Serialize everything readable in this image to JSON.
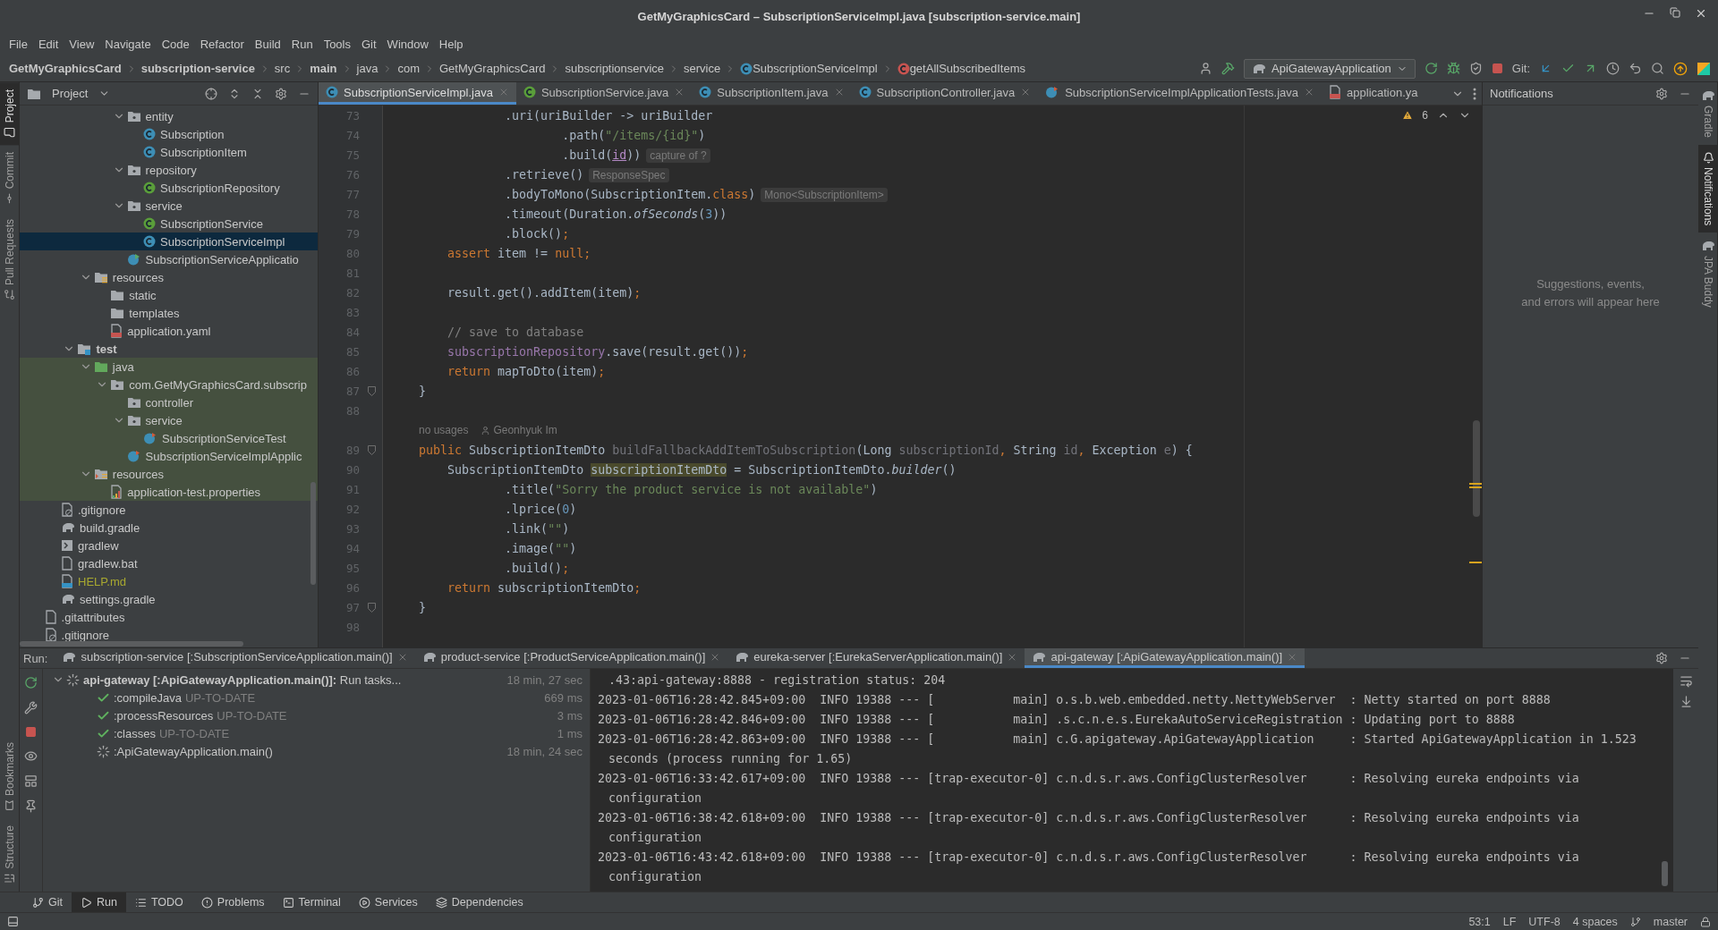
{
  "window": {
    "title": "GetMyGraphicsCard – SubscriptionServiceImpl.java [subscription-service.main]"
  },
  "menu": [
    "File",
    "Edit",
    "View",
    "Navigate",
    "Code",
    "Refactor",
    "Build",
    "Run",
    "Tools",
    "Git",
    "Window",
    "Help"
  ],
  "breadcrumbs": [
    {
      "label": "GetMyGraphicsCard",
      "bold": true
    },
    {
      "label": "subscription-service",
      "bold": true
    },
    {
      "label": "src"
    },
    {
      "label": "main",
      "bold": true
    },
    {
      "label": "java"
    },
    {
      "label": "com"
    },
    {
      "label": "GetMyGraphicsCard"
    },
    {
      "label": "subscriptionservice"
    },
    {
      "label": "service"
    },
    {
      "label": "SubscriptionServiceImpl",
      "kind": "class"
    },
    {
      "label": "getAllSubscribedItems",
      "kind": "method"
    }
  ],
  "toolbar": {
    "run_config": "ApiGatewayApplication",
    "git_label": "Git:"
  },
  "left_stripe": {
    "top": [
      {
        "label": "Project",
        "kind": "folder",
        "selected": true
      },
      {
        "label": "Commit",
        "kind": "commit",
        "selected": false
      },
      {
        "label": "Pull Requests",
        "kind": "pull",
        "selected": false
      }
    ],
    "bottom": [
      {
        "label": "Bookmarks",
        "kind": "bookmark",
        "selected": false
      },
      {
        "label": "Structure",
        "kind": "structure",
        "selected": false
      }
    ]
  },
  "right_stripe": [
    {
      "label": "Gradle",
      "kind": "gradle",
      "selected": false
    },
    {
      "label": "Notifications",
      "kind": "bell",
      "selected": true
    },
    {
      "label": "JPA Buddy",
      "kind": "gradle",
      "selected": false
    }
  ],
  "project": {
    "title": "Project",
    "items": [
      {
        "children": [
          {
            "children": [
              {
                "children": [
                  {
                    "children": [
                      {
                        "children": [
                          {
                            "label": "entity",
                            "kind": "package",
                            "expanded": true,
                            "children": [
                              {
                                "label": "Subscription",
                                "kind": "class"
                              },
                              {
                                "label": "SubscriptionItem",
                                "kind": "class"
                              }
                            ]
                          },
                          {
                            "label": "repository",
                            "kind": "package",
                            "expanded": true,
                            "children": [
                              {
                                "label": "SubscriptionRepository",
                                "kind": "interface"
                              }
                            ]
                          },
                          {
                            "label": "service",
                            "kind": "package",
                            "expanded": true,
                            "children": [
                              {
                                "label": "SubscriptionService",
                                "kind": "interface"
                              },
                              {
                                "label": "SubscriptionServiceImpl",
                                "kind": "class",
                                "selected": true
                              }
                            ]
                          },
                          {
                            "label": "SubscriptionServiceApplicatio",
                            "kind": "app-class"
                          }
                        ]
                      }
                    ]
                  },
                  {
                    "label": "resources",
                    "kind": "resources-folder",
                    "expanded": true,
                    "children": [
                      {
                        "label": "static",
                        "kind": "folder"
                      },
                      {
                        "label": "templates",
                        "kind": "folder"
                      },
                      {
                        "label": "application.yaml",
                        "kind": "yaml"
                      }
                    ]
                  }
                ]
              },
              {
                "label": "test",
                "kind": "test-root",
                "expanded": true,
                "bold": true,
                "children": [
                  {
                    "label": "java",
                    "kind": "source-folder",
                    "expanded": true,
                    "highlighted": true,
                    "children": [
                      {
                        "label": "com.GetMyGraphicsCard.subscrip",
                        "kind": "package",
                        "expanded": true,
                        "highlighted": true,
                        "children": [
                          {
                            "label": "controller",
                            "kind": "package",
                            "highlighted": true
                          },
                          {
                            "label": "service",
                            "kind": "package",
                            "expanded": true,
                            "highlighted": true,
                            "children": [
                              {
                                "label": "SubscriptionServiceTest",
                                "kind": "test-class",
                                "highlighted": true
                              }
                            ]
                          },
                          {
                            "label": "SubscriptionServiceImplApplic",
                            "kind": "test-class",
                            "highlighted": true
                          }
                        ]
                      }
                    ]
                  },
                  {
                    "label": "resources",
                    "kind": "test-resources",
                    "expanded": true,
                    "highlighted": true,
                    "children": [
                      {
                        "label": "application-test.properties",
                        "kind": "properties",
                        "highlighted": true
                      }
                    ]
                  }
                ]
              }
            ]
          },
          {
            "label": ".gitignore",
            "kind": "ignore"
          },
          {
            "label": "build.gradle",
            "kind": "gradle"
          },
          {
            "label": "gradlew",
            "kind": "script"
          },
          {
            "label": "gradlew.bat",
            "kind": "text"
          },
          {
            "label": "HELP.md",
            "kind": "markdown",
            "unversioned": true
          },
          {
            "label": "settings.gradle",
            "kind": "gradle"
          }
        ]
      },
      {
        "label": ".gitattributes",
        "kind": "text"
      },
      {
        "label": ".gitignore",
        "kind": "ignore"
      }
    ]
  },
  "editor": {
    "tabs": [
      {
        "label": "SubscriptionServiceImpl.java",
        "kind": "class",
        "selected": true,
        "closable": true
      },
      {
        "label": "SubscriptionService.java",
        "kind": "interface",
        "selected": false,
        "closable": true
      },
      {
        "label": "SubscriptionItem.java",
        "kind": "class",
        "selected": false,
        "closable": true
      },
      {
        "label": "SubscriptionController.java",
        "kind": "class",
        "selected": false,
        "closable": true
      },
      {
        "label": "SubscriptionServiceImplApplicationTests.java",
        "kind": "test-class",
        "selected": false,
        "closable": true
      },
      {
        "label": "application.ya",
        "kind": "yaml",
        "selected": false,
        "closable": false
      }
    ],
    "warnings": "6",
    "lines": [
      {
        "kind": "code",
        "number": "73",
        "tokens": [
          {
            "kind": "plain",
            "text": "                .uri(uriBuilder -> uriBuilder"
          }
        ]
      },
      {
        "kind": "code",
        "number": "74",
        "tokens": [
          {
            "kind": "plain",
            "text": "                        .path("
          },
          {
            "kind": "string",
            "text": "\"/items/{id}\""
          },
          {
            "kind": "plain",
            "text": ")"
          }
        ]
      },
      {
        "kind": "code",
        "number": "75",
        "tokens": [
          {
            "kind": "plain",
            "text": "                        .build("
          },
          {
            "kind": "ref",
            "text": "id"
          },
          {
            "kind": "plain",
            "text": "))"
          },
          {
            "kind": "hint",
            "text": "capture of ?"
          }
        ]
      },
      {
        "kind": "code",
        "number": "76",
        "tokens": [
          {
            "kind": "plain",
            "text": "                .retrieve()"
          },
          {
            "kind": "hint",
            "text": "ResponseSpec"
          }
        ]
      },
      {
        "kind": "code",
        "number": "77",
        "tokens": [
          {
            "kind": "plain",
            "text": "                .bodyToMono(SubscriptionItem."
          },
          {
            "kind": "keyword",
            "text": "class"
          },
          {
            "kind": "plain",
            "text": ")"
          },
          {
            "kind": "hint",
            "text": "Mono<SubscriptionItem>"
          }
        ]
      },
      {
        "kind": "code",
        "number": "78",
        "tokens": [
          {
            "kind": "plain",
            "text": "                .timeout(Duration."
          },
          {
            "kind": "italic",
            "text": "ofSeconds"
          },
          {
            "kind": "plain",
            "text": "("
          },
          {
            "kind": "number",
            "text": "3"
          },
          {
            "kind": "plain",
            "text": "))"
          }
        ]
      },
      {
        "kind": "code",
        "number": "79",
        "tokens": [
          {
            "kind": "plain",
            "text": "                .block()"
          },
          {
            "kind": "keyword",
            "text": ";"
          }
        ]
      },
      {
        "kind": "code",
        "number": "80",
        "tokens": [
          {
            "kind": "keyword",
            "text": "        assert"
          },
          {
            "kind": "plain",
            "text": " item != "
          },
          {
            "kind": "keyword",
            "text": "null;"
          }
        ]
      },
      {
        "kind": "code",
        "number": "81"
      },
      {
        "kind": "code",
        "number": "82",
        "tokens": [
          {
            "kind": "plain",
            "text": "        result.get().addItem(item)"
          },
          {
            "kind": "keyword",
            "text": ";"
          }
        ]
      },
      {
        "kind": "code",
        "number": "83"
      },
      {
        "kind": "code",
        "number": "84",
        "tokens": [
          {
            "kind": "comment",
            "text": "        // save to database"
          }
        ]
      },
      {
        "kind": "code",
        "number": "85",
        "tokens": [
          {
            "kind": "field",
            "text": "        subscriptionRepository"
          },
          {
            "kind": "plain",
            "text": ".save(result.get())"
          },
          {
            "kind": "keyword",
            "text": ";"
          }
        ]
      },
      {
        "kind": "code",
        "number": "86",
        "tokens": [
          {
            "kind": "keyword",
            "text": "        return"
          },
          {
            "kind": "plain",
            "text": " mapToDto(item)"
          },
          {
            "kind": "keyword",
            "text": ";"
          }
        ]
      },
      {
        "kind": "code",
        "number": "87",
        "fold": true,
        "tokens": [
          {
            "kind": "plain",
            "text": "    }"
          }
        ]
      },
      {
        "kind": "code",
        "number": "88"
      },
      {
        "kind": "lens",
        "usages": "no usages",
        "author": "Geonhyuk Im"
      },
      {
        "kind": "code",
        "number": "89",
        "fold": true,
        "tokens": [
          {
            "kind": "keyword",
            "text": "    public"
          },
          {
            "kind": "plain",
            "text": " SubscriptionItemDto "
          },
          {
            "kind": "dim",
            "text": "buildFallbackAddItemToSubscription"
          },
          {
            "kind": "plain",
            "text": "(Long "
          },
          {
            "kind": "dim",
            "text": "subscriptionId"
          },
          {
            "kind": "keyword",
            "text": ","
          },
          {
            "kind": "plain",
            "text": " String "
          },
          {
            "kind": "dim",
            "text": "id"
          },
          {
            "kind": "keyword",
            "text": ","
          },
          {
            "kind": "plain",
            "text": " Exception "
          },
          {
            "kind": "dim",
            "text": "e"
          },
          {
            "kind": "plain",
            "text": ") {"
          }
        ]
      },
      {
        "kind": "code",
        "number": "90",
        "tokens": [
          {
            "kind": "plain",
            "text": "        SubscriptionItemDto "
          },
          {
            "kind": "highlight",
            "text": "subscriptionItemDto"
          },
          {
            "kind": "plain",
            "text": " = SubscriptionItemDto."
          },
          {
            "kind": "italic",
            "text": "builder"
          },
          {
            "kind": "plain",
            "text": "()"
          }
        ]
      },
      {
        "kind": "code",
        "number": "91",
        "tokens": [
          {
            "kind": "plain",
            "text": "                .title("
          },
          {
            "kind": "string",
            "text": "\"Sorry the product service is not available\""
          },
          {
            "kind": "plain",
            "text": ")"
          }
        ]
      },
      {
        "kind": "code",
        "number": "92",
        "tokens": [
          {
            "kind": "plain",
            "text": "                .lprice("
          },
          {
            "kind": "number",
            "text": "0"
          },
          {
            "kind": "plain",
            "text": ")"
          }
        ]
      },
      {
        "kind": "code",
        "number": "93",
        "tokens": [
          {
            "kind": "plain",
            "text": "                .link("
          },
          {
            "kind": "string",
            "text": "\"\""
          },
          {
            "kind": "plain",
            "text": ")"
          }
        ]
      },
      {
        "kind": "code",
        "number": "94",
        "tokens": [
          {
            "kind": "plain",
            "text": "                .image("
          },
          {
            "kind": "string",
            "text": "\"\""
          },
          {
            "kind": "plain",
            "text": ")"
          }
        ]
      },
      {
        "kind": "code",
        "number": "95",
        "tokens": [
          {
            "kind": "plain",
            "text": "                .build()"
          },
          {
            "kind": "keyword",
            "text": ";"
          }
        ]
      },
      {
        "kind": "code",
        "number": "96",
        "tokens": [
          {
            "kind": "keyword",
            "text": "        return"
          },
          {
            "kind": "plain",
            "text": " subscriptionItemDto"
          },
          {
            "kind": "keyword",
            "text": ";"
          }
        ]
      },
      {
        "kind": "code",
        "number": "97",
        "fold": true,
        "tokens": [
          {
            "kind": "plain",
            "text": "    }"
          }
        ]
      },
      {
        "kind": "code",
        "number": "98"
      }
    ]
  },
  "notifications": {
    "title": "Notifications",
    "empty_text": [
      "Suggestions, events,",
      "and errors will appear here"
    ]
  },
  "run": {
    "label": "Run:",
    "tabs": [
      {
        "label": "subscription-service [:SubscriptionServiceApplication.main()]",
        "selected": false
      },
      {
        "label": "product-service [:ProductServiceApplication.main()]",
        "selected": false
      },
      {
        "label": "eureka-server [:EurekaServerApplication.main()]",
        "selected": false
      },
      {
        "label": "api-gateway [:ApiGatewayApplication.main()]",
        "selected": true
      }
    ],
    "tasks": [
      {
        "label": "**api-gateway [:ApiGatewayApplication.main()]:** Run tasks...",
        "done": false,
        "time": "18 min, 27 sec",
        "expanded": true,
        "children": [
          {
            "label": ":compileJava",
            "note": "UP-TO-DATE",
            "done": true,
            "time": "669 ms"
          },
          {
            "label": ":processResources",
            "note": "UP-TO-DATE",
            "done": true,
            "time": "3 ms"
          },
          {
            "label": ":classes",
            "note": "UP-TO-DATE",
            "done": true,
            "time": "1 ms"
          },
          {
            "label": ":ApiGatewayApplication.main()",
            "done": false,
            "time": "18 min, 24 sec"
          }
        ]
      }
    ],
    "console": [
      {
        "kind": "continuation",
        "text": ".43:api-gateway:8888 - registration status: 204"
      },
      {
        "kind": "entry",
        "text": "2023-01-06T16:28:42.845+09:00  INFO 19388 --- [           main] o.s.b.web.embedded.netty.NettyWebServer  : Netty started on port 8888"
      },
      {
        "kind": "entry",
        "text": "2023-01-06T16:28:42.846+09:00  INFO 19388 --- [           main] .s.c.n.e.s.EurekaAutoServiceRegistration : Updating port to 8888"
      },
      {
        "kind": "entry",
        "text": "2023-01-06T16:28:42.863+09:00  INFO 19388 --- [           main] c.G.apigateway.ApiGatewayApplication     : Started ApiGatewayApplication in 1.523 seconds (process running for 1.65)"
      },
      {
        "kind": "entry",
        "text": "2023-01-06T16:33:42.617+09:00  INFO 19388 --- [trap-executor-0] c.n.d.s.r.aws.ConfigClusterResolver      : Resolving eureka endpoints via configuration"
      },
      {
        "kind": "entry",
        "text": "2023-01-06T16:38:42.618+09:00  INFO 19388 --- [trap-executor-0] c.n.d.s.r.aws.ConfigClusterResolver      : Resolving eureka endpoints via configuration"
      },
      {
        "kind": "entry",
        "text": "2023-01-06T16:43:42.618+09:00  INFO 19388 --- [trap-executor-0] c.n.d.s.r.aws.ConfigClusterResolver      : Resolving eureka endpoints via configuration"
      }
    ]
  },
  "bottom_tabs": [
    {
      "label": "Git",
      "kind": "git",
      "selected": false
    },
    {
      "label": "Run",
      "kind": "run",
      "selected": true
    },
    {
      "label": "TODO",
      "kind": "list",
      "selected": false
    },
    {
      "label": "Problems",
      "kind": "problems",
      "selected": false
    },
    {
      "label": "Terminal",
      "kind": "terminal",
      "selected": false
    },
    {
      "label": "Services",
      "kind": "services",
      "selected": false
    },
    {
      "label": "Dependencies",
      "kind": "layers",
      "selected": false
    }
  ],
  "status_bar": {
    "position": "53:1",
    "line_separator": "LF",
    "encoding": "UTF-8",
    "indent": "4 spaces",
    "branch": "master"
  }
}
